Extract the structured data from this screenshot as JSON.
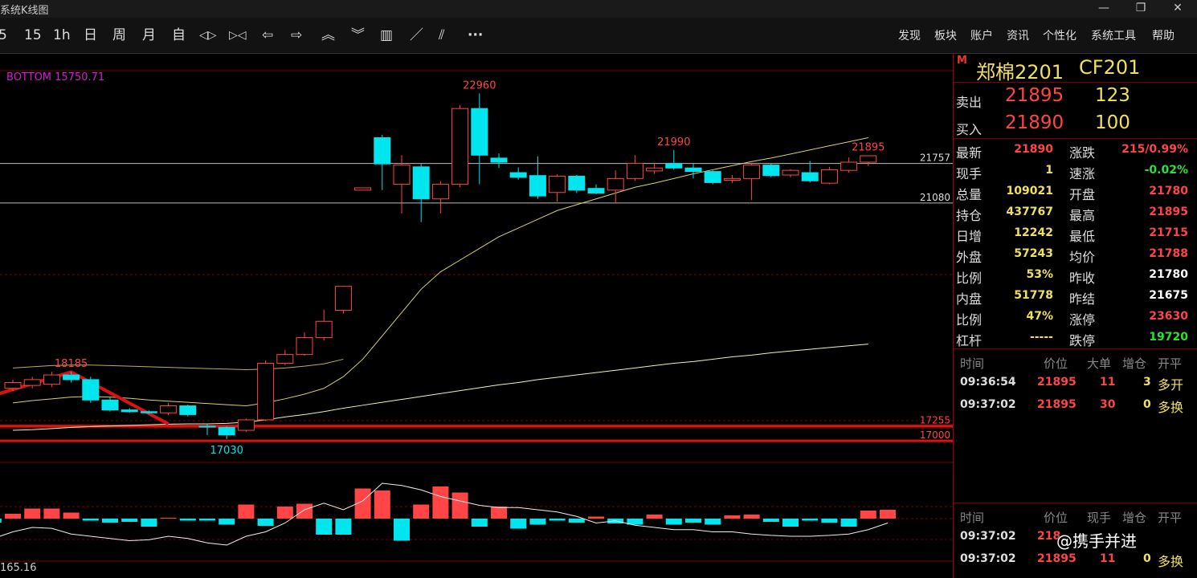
{
  "window": {
    "title": "系统K线图",
    "controls": [
      "—",
      "❐",
      "✕"
    ]
  },
  "toolbar": {
    "buttons": [
      {
        "name": "period-5min-button",
        "label": "5"
      },
      {
        "name": "period-15min-button",
        "label": "15"
      },
      {
        "name": "period-1h-button",
        "label": "1h"
      },
      {
        "name": "period-day-button",
        "label": "日"
      },
      {
        "name": "period-week-button",
        "label": "周"
      },
      {
        "name": "period-month-button",
        "label": "月"
      },
      {
        "name": "period-custom-button",
        "label": "自"
      },
      {
        "name": "zoom-in-icon",
        "label": "◁▷"
      },
      {
        "name": "zoom-out-icon",
        "label": "▷◁"
      },
      {
        "name": "move-left-icon",
        "label": "⇦"
      },
      {
        "name": "move-right-icon",
        "label": "⇨"
      },
      {
        "name": "scroll-up-icon",
        "label": "︽"
      },
      {
        "name": "scroll-down-icon",
        "label": "︾"
      },
      {
        "name": "layout-icon",
        "label": "▥"
      },
      {
        "name": "draw-line-icon",
        "label": "／"
      },
      {
        "name": "draw-parallel-icon",
        "label": "⫽"
      },
      {
        "name": "more-icon",
        "label": "···"
      }
    ],
    "menus": [
      "发现",
      "板块",
      "账户",
      "资讯",
      "个性化",
      "系统工具",
      "帮助"
    ]
  },
  "chart": {
    "bottom_label": "BOTTOM 15750.71",
    "indicator_value": "165.16",
    "price_labels": {
      "high": "22960",
      "peak2": "21990",
      "last_high": "21895",
      "left_high": "18185",
      "low": "17030"
    },
    "level_labels": [
      "21757",
      "21080",
      "17255",
      "17000"
    ]
  },
  "chart_data": {
    "type": "candlestick",
    "title": "",
    "ylim": [
      16850,
      23350
    ],
    "candles": [
      {
        "o": 17900,
        "c": 18000,
        "h": 18050,
        "l": 17850
      },
      {
        "o": 17950,
        "c": 18050,
        "h": 18100,
        "l": 17900
      },
      {
        "o": 17970,
        "c": 18130,
        "h": 18185,
        "l": 17920
      },
      {
        "o": 18130,
        "c": 18050,
        "h": 18185,
        "l": 18000
      },
      {
        "o": 18050,
        "c": 17700,
        "h": 18100,
        "l": 17650
      },
      {
        "o": 17700,
        "c": 17530,
        "h": 17750,
        "l": 17500
      },
      {
        "o": 17530,
        "c": 17500,
        "h": 17560,
        "l": 17480
      },
      {
        "o": 17500,
        "c": 17480,
        "h": 17520,
        "l": 17460
      },
      {
        "o": 17480,
        "c": 17600,
        "h": 17650,
        "l": 17440
      },
      {
        "o": 17600,
        "c": 17450,
        "h": 17620,
        "l": 17420
      },
      {
        "o": 17250,
        "c": 17240,
        "h": 17300,
        "l": 17100
      },
      {
        "o": 17230,
        "c": 17100,
        "h": 17250,
        "l": 17030
      },
      {
        "o": 17180,
        "c": 17360,
        "h": 17380,
        "l": 17150
      },
      {
        "o": 17360,
        "c": 18330,
        "h": 18380,
        "l": 17340
      },
      {
        "o": 18330,
        "c": 18480,
        "h": 18560,
        "l": 18300
      },
      {
        "o": 18480,
        "c": 18770,
        "h": 18860,
        "l": 18460
      },
      {
        "o": 18770,
        "c": 19050,
        "h": 19250,
        "l": 18720
      },
      {
        "o": 19240,
        "c": 19650,
        "h": 19660,
        "l": 19180
      },
      {
        "o": 21300,
        "c": 21340,
        "h": 21340,
        "l": 21300
      },
      {
        "o": 22200,
        "c": 21750,
        "h": 22250,
        "l": 21300
      },
      {
        "o": 21400,
        "c": 21730,
        "h": 21900,
        "l": 20900
      },
      {
        "o": 21700,
        "c": 21150,
        "h": 21750,
        "l": 20750
      },
      {
        "o": 21150,
        "c": 21400,
        "h": 21450,
        "l": 20900
      },
      {
        "o": 21400,
        "c": 22700,
        "h": 22760,
        "l": 21350
      },
      {
        "o": 22700,
        "c": 21900,
        "h": 22960,
        "l": 21400
      },
      {
        "o": 21850,
        "c": 21780,
        "h": 21930,
        "l": 21680
      },
      {
        "o": 21600,
        "c": 21520,
        "h": 21690,
        "l": 21480
      },
      {
        "o": 21550,
        "c": 21200,
        "h": 21880,
        "l": 21150
      },
      {
        "o": 21260,
        "c": 21540,
        "h": 21570,
        "l": 21100
      },
      {
        "o": 21540,
        "c": 21300,
        "h": 21560,
        "l": 21250
      },
      {
        "o": 21330,
        "c": 21250,
        "h": 21400,
        "l": 21230
      },
      {
        "o": 21300,
        "c": 21500,
        "h": 21640,
        "l": 21080
      },
      {
        "o": 21500,
        "c": 21760,
        "h": 21900,
        "l": 21460
      },
      {
        "o": 21630,
        "c": 21680,
        "h": 21760,
        "l": 21580
      },
      {
        "o": 21760,
        "c": 21680,
        "h": 21990,
        "l": 21650
      },
      {
        "o": 21680,
        "c": 21620,
        "h": 21760,
        "l": 21500
      },
      {
        "o": 21620,
        "c": 21430,
        "h": 21640,
        "l": 21400
      },
      {
        "o": 21470,
        "c": 21500,
        "h": 21560,
        "l": 21420
      },
      {
        "o": 21500,
        "c": 21730,
        "h": 21770,
        "l": 21130
      },
      {
        "o": 21730,
        "c": 21550,
        "h": 21760,
        "l": 21520
      },
      {
        "o": 21560,
        "c": 21640,
        "h": 21660,
        "l": 21520
      },
      {
        "o": 21600,
        "c": 21460,
        "h": 21800,
        "l": 21430
      },
      {
        "o": 21420,
        "c": 21650,
        "h": 21700,
        "l": 21400
      },
      {
        "o": 21640,
        "c": 21780,
        "h": 21860,
        "l": 21600
      },
      {
        "o": 21780,
        "c": 21890,
        "h": 21895,
        "l": 21715
      }
    ],
    "ma_short": [
      17650,
      17690,
      17720,
      17750,
      17760,
      17750,
      17730,
      17700,
      17680,
      17660,
      17640,
      17620,
      17600,
      17650,
      17720,
      17800,
      17900,
      18100,
      18400,
      18800,
      19200,
      19600,
      19900,
      20100,
      20300,
      20500,
      20650,
      20800,
      20950,
      21050,
      21150,
      21250,
      21350,
      21420,
      21500,
      21580,
      21650,
      21720,
      21790,
      21850,
      21920,
      21990,
      22060,
      22130,
      22200
    ],
    "ma_long": [
      17180,
      17190,
      17210,
      17230,
      17245,
      17255,
      17265,
      17275,
      17285,
      17290,
      17290,
      17300,
      17320,
      17360,
      17410,
      17450,
      17500,
      17560,
      17610,
      17660,
      17710,
      17760,
      17810,
      17860,
      17910,
      17960,
      18000,
      18050,
      18090,
      18130,
      18170,
      18210,
      18250,
      18290,
      18330,
      18360,
      18400,
      18440,
      18470,
      18510,
      18540,
      18570,
      18600,
      18630,
      18660
    ],
    "ma_upper": [
      18250,
      18270,
      18290,
      18300,
      18300,
      18290,
      18280,
      18270,
      18260,
      18250,
      18240,
      18230,
      18220,
      18230,
      18250,
      18280,
      18320,
      18400
    ],
    "bottom_line_pts": [
      [
        -1,
        17780
      ],
      [
        3,
        18180
      ],
      [
        8,
        17290
      ]
    ],
    "levels": [
      21757,
      21080,
      17255,
      17000
    ],
    "volume": [
      -10,
      12,
      25,
      25,
      15,
      -5,
      -10,
      -8,
      -20,
      2,
      -5,
      -5,
      -15,
      35,
      -18,
      30,
      37,
      -40,
      -40,
      75,
      70,
      -55,
      35,
      80,
      65,
      -20,
      30,
      -25,
      -15,
      -5,
      -10,
      5,
      -12,
      -15,
      10,
      -15,
      -10,
      -15,
      8,
      10,
      -8,
      -20,
      -5,
      -10,
      -20,
      20,
      22
    ],
    "volume_line": [
      -45,
      -30,
      -20,
      -22,
      -35,
      -40,
      -45,
      -50,
      -48,
      -40,
      -45,
      -55,
      -60,
      -40,
      -30,
      -10,
      20,
      35,
      20,
      40,
      80,
      75,
      65,
      50,
      40,
      30,
      25,
      25,
      20,
      15,
      5,
      -10,
      -5,
      -15,
      -20,
      -25,
      -25,
      -30,
      -30,
      -35,
      -38,
      -40,
      -40,
      -38,
      -35,
      -25,
      -10
    ]
  },
  "panel": {
    "marker": "M",
    "name": "郑棉2201",
    "code": "CF201",
    "sell": {
      "label": "卖出",
      "price": "21895",
      "volume": "123"
    },
    "buy": {
      "label": "买入",
      "price": "21890",
      "volume": "100"
    },
    "quotes": [
      {
        "l": "最新",
        "v": "21890",
        "vc": "#ff4545",
        "l2": "涨跌",
        "v2": "215/0.99%",
        "v2c": "#ff4545"
      },
      {
        "l": "现手",
        "v": "1",
        "vc": "#f0e060",
        "l2": "速涨",
        "v2": "-0.02%",
        "v2c": "#30e030"
      },
      {
        "l": "总量",
        "v": "109021",
        "vc": "#f0e060",
        "l2": "开盘",
        "v2": "21780",
        "v2c": "#ff4545"
      },
      {
        "l": "持仓",
        "v": "437767",
        "vc": "#f0e060",
        "l2": "最高",
        "v2": "21895",
        "v2c": "#ff4545"
      },
      {
        "l": "日增",
        "v": "12242",
        "vc": "#f0e060",
        "l2": "最低",
        "v2": "21715",
        "v2c": "#ff4545"
      },
      {
        "l": "外盘",
        "v": "57243",
        "vc": "#f0e060",
        "l2": "均价",
        "v2": "21788",
        "v2c": "#ff4545"
      },
      {
        "l": "比例",
        "v": "53%",
        "vc": "#f0e060",
        "l2": "昨收",
        "v2": "21780",
        "v2c": "#ffffff"
      },
      {
        "l": "内盘",
        "v": "51778",
        "vc": "#f0e060",
        "l2": "昨结",
        "v2": "21675",
        "v2c": "#ffffff"
      },
      {
        "l": "比例",
        "v": "47%",
        "vc": "#f0e060",
        "l2": "涨停",
        "v2": "23630",
        "v2c": "#ff4545"
      },
      {
        "l": "杠杆",
        "v": "-----",
        "vc": "#f0e060",
        "l2": "跌停",
        "v2": "19720",
        "v2c": "#30e030"
      }
    ],
    "tick_header1": [
      "时间",
      "价位",
      "大单",
      "增仓",
      "开平"
    ],
    "ticks1": [
      {
        "time": "09:36:54",
        "price": "21895",
        "vol": "11",
        "inc": "3",
        "type": "多开"
      },
      {
        "time": "09:37:02",
        "price": "21895",
        "vol": "30",
        "inc": "0",
        "type": "多换"
      }
    ],
    "tick_header2": [
      "时间",
      "价位",
      "现手",
      "增仓",
      "开平"
    ],
    "ticks2": [
      {
        "time": "09:37:02",
        "price": "218",
        "vol": "",
        "inc": "",
        "type": ""
      },
      {
        "time": "09:37:02",
        "price": "21895",
        "vol": "11",
        "inc": "0",
        "type": "多换"
      }
    ]
  },
  "watermark": "@携手并进",
  "colors": {
    "up": "#ff4545",
    "down": "#00e5ee",
    "ma_short": "#d8d070",
    "ma_long": "#f0f0c0",
    "level": "#e01010",
    "grid": "#7a0000"
  }
}
